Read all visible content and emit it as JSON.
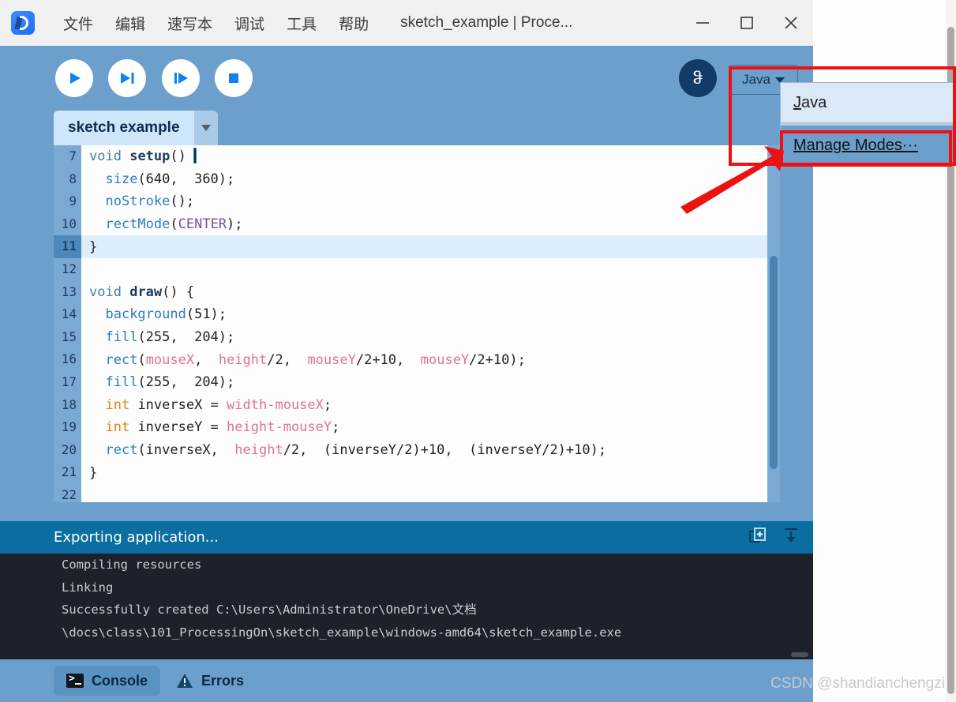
{
  "window": {
    "title": "sketch_example | Proce...",
    "app_icon": "processing-logo-icon",
    "menu": [
      "文件",
      "编辑",
      "速写本",
      "调试",
      "工具",
      "帮助"
    ],
    "controls": {
      "minimize": "minimize-icon",
      "maximize": "maximize-icon",
      "close": "close-icon"
    }
  },
  "toolbar": {
    "buttons": [
      {
        "name": "run-button",
        "icon": "play-icon"
      },
      {
        "name": "step-button",
        "icon": "step-over-icon"
      },
      {
        "name": "continue-button",
        "icon": "step-into-icon"
      },
      {
        "name": "stop-button",
        "icon": "stop-icon"
      }
    ],
    "debug_toggle_glyph": "ჵ",
    "mode_label": "Java"
  },
  "mode_menu": {
    "items": [
      {
        "label": "Java",
        "mnemonic": "J",
        "rest": "ava",
        "selected": false
      },
      {
        "label": "Manage Modes···",
        "mnemonic": "M",
        "rest": "anage Modes···",
        "selected": true
      }
    ]
  },
  "sketch_tab": {
    "name": "sketch example",
    "dropdown_icon": "chevron-down-icon"
  },
  "editor": {
    "lines": [
      {
        "num": "7",
        "active": false,
        "tokens": [
          {
            "t": "void",
            "c": "k-type"
          },
          {
            "t": " ",
            "c": ""
          },
          {
            "t": "setup",
            "c": "k-fn"
          },
          {
            "t": "() ",
            "c": ""
          },
          {
            "t": "{",
            "c": "cursor-brace"
          }
        ]
      },
      {
        "num": "8",
        "active": false,
        "tokens": [
          {
            "t": "  ",
            "c": ""
          },
          {
            "t": "size",
            "c": "k-call"
          },
          {
            "t": "(640,  360);",
            "c": ""
          }
        ]
      },
      {
        "num": "9",
        "active": false,
        "tokens": [
          {
            "t": "  ",
            "c": ""
          },
          {
            "t": "noStroke",
            "c": "k-call"
          },
          {
            "t": "();",
            "c": ""
          }
        ]
      },
      {
        "num": "10",
        "active": false,
        "tokens": [
          {
            "t": "  ",
            "c": ""
          },
          {
            "t": "rectMode",
            "c": "k-call"
          },
          {
            "t": "(",
            "c": ""
          },
          {
            "t": "CENTER",
            "c": "k-const"
          },
          {
            "t": ");",
            "c": ""
          }
        ]
      },
      {
        "num": "11",
        "active": true,
        "tokens": [
          {
            "t": "}",
            "c": ""
          }
        ]
      },
      {
        "num": "12",
        "active": false,
        "tokens": [
          {
            "t": "",
            "c": ""
          }
        ]
      },
      {
        "num": "13",
        "active": false,
        "tokens": [
          {
            "t": "void",
            "c": "k-type"
          },
          {
            "t": " ",
            "c": ""
          },
          {
            "t": "draw",
            "c": "k-fn"
          },
          {
            "t": "() {",
            "c": ""
          }
        ]
      },
      {
        "num": "14",
        "active": false,
        "tokens": [
          {
            "t": "  ",
            "c": ""
          },
          {
            "t": "background",
            "c": "k-call"
          },
          {
            "t": "(51);",
            "c": ""
          }
        ]
      },
      {
        "num": "15",
        "active": false,
        "tokens": [
          {
            "t": "  ",
            "c": ""
          },
          {
            "t": "fill",
            "c": "k-call"
          },
          {
            "t": "(255,  204);",
            "c": ""
          }
        ]
      },
      {
        "num": "16",
        "active": false,
        "tokens": [
          {
            "t": "  ",
            "c": ""
          },
          {
            "t": "rect",
            "c": "k-call"
          },
          {
            "t": "(",
            "c": ""
          },
          {
            "t": "mouseX",
            "c": "k-var"
          },
          {
            "t": ",  ",
            "c": ""
          },
          {
            "t": "height",
            "c": "k-var"
          },
          {
            "t": "/2,  ",
            "c": ""
          },
          {
            "t": "mouseY",
            "c": "k-var"
          },
          {
            "t": "/2+10,  ",
            "c": ""
          },
          {
            "t": "mouseY",
            "c": "k-var"
          },
          {
            "t": "/2+10);",
            "c": ""
          }
        ]
      },
      {
        "num": "17",
        "active": false,
        "tokens": [
          {
            "t": "  ",
            "c": ""
          },
          {
            "t": "fill",
            "c": "k-call"
          },
          {
            "t": "(255,  204);",
            "c": ""
          }
        ]
      },
      {
        "num": "18",
        "active": false,
        "tokens": [
          {
            "t": "  ",
            "c": ""
          },
          {
            "t": "int",
            "c": "k-kw"
          },
          {
            "t": " inverseX = ",
            "c": ""
          },
          {
            "t": "width",
            "c": "k-var"
          },
          {
            "t": "-",
            "c": "k-var"
          },
          {
            "t": "mouseX",
            "c": "k-var"
          },
          {
            "t": ";",
            "c": ""
          }
        ]
      },
      {
        "num": "19",
        "active": false,
        "tokens": [
          {
            "t": "  ",
            "c": ""
          },
          {
            "t": "int",
            "c": "k-kw"
          },
          {
            "t": " inverseY = ",
            "c": ""
          },
          {
            "t": "height",
            "c": "k-var"
          },
          {
            "t": "-",
            "c": "k-var"
          },
          {
            "t": "mouseY",
            "c": "k-var"
          },
          {
            "t": ";",
            "c": ""
          }
        ]
      },
      {
        "num": "20",
        "active": false,
        "tokens": [
          {
            "t": "  ",
            "c": ""
          },
          {
            "t": "rect",
            "c": "k-call"
          },
          {
            "t": "(inverseX,  ",
            "c": ""
          },
          {
            "t": "height",
            "c": "k-var"
          },
          {
            "t": "/2,  (inverseY/2)+10,  (inverseY/2)+10);",
            "c": ""
          }
        ]
      },
      {
        "num": "21",
        "active": false,
        "tokens": [
          {
            "t": "}",
            "c": ""
          }
        ]
      },
      {
        "num": "22",
        "active": false,
        "tokens": [
          {
            "t": "",
            "c": ""
          }
        ]
      }
    ]
  },
  "console": {
    "status": "Exporting application...",
    "tools": [
      {
        "name": "copy-to-new-icon"
      },
      {
        "name": "scroll-to-bottom-icon"
      }
    ],
    "output": [
      "Compiling resources",
      "Linking",
      "Successfully created C:\\Users\\Administrator\\OneDrive\\文档",
      "\\docs\\class\\101_ProcessingOn\\sketch_example\\windows-amd64\\sketch_example.exe"
    ],
    "tabs": [
      {
        "label": "Console",
        "icon": "terminal-icon",
        "active": true
      },
      {
        "label": "Errors",
        "icon": "warning-icon",
        "active": false
      }
    ]
  },
  "annotation": {
    "color": "#ee1111",
    "arrow": "red-arrow-pointing-to-manage-modes"
  },
  "watermark": {
    "text": "CSDN @shandianchengzi"
  }
}
